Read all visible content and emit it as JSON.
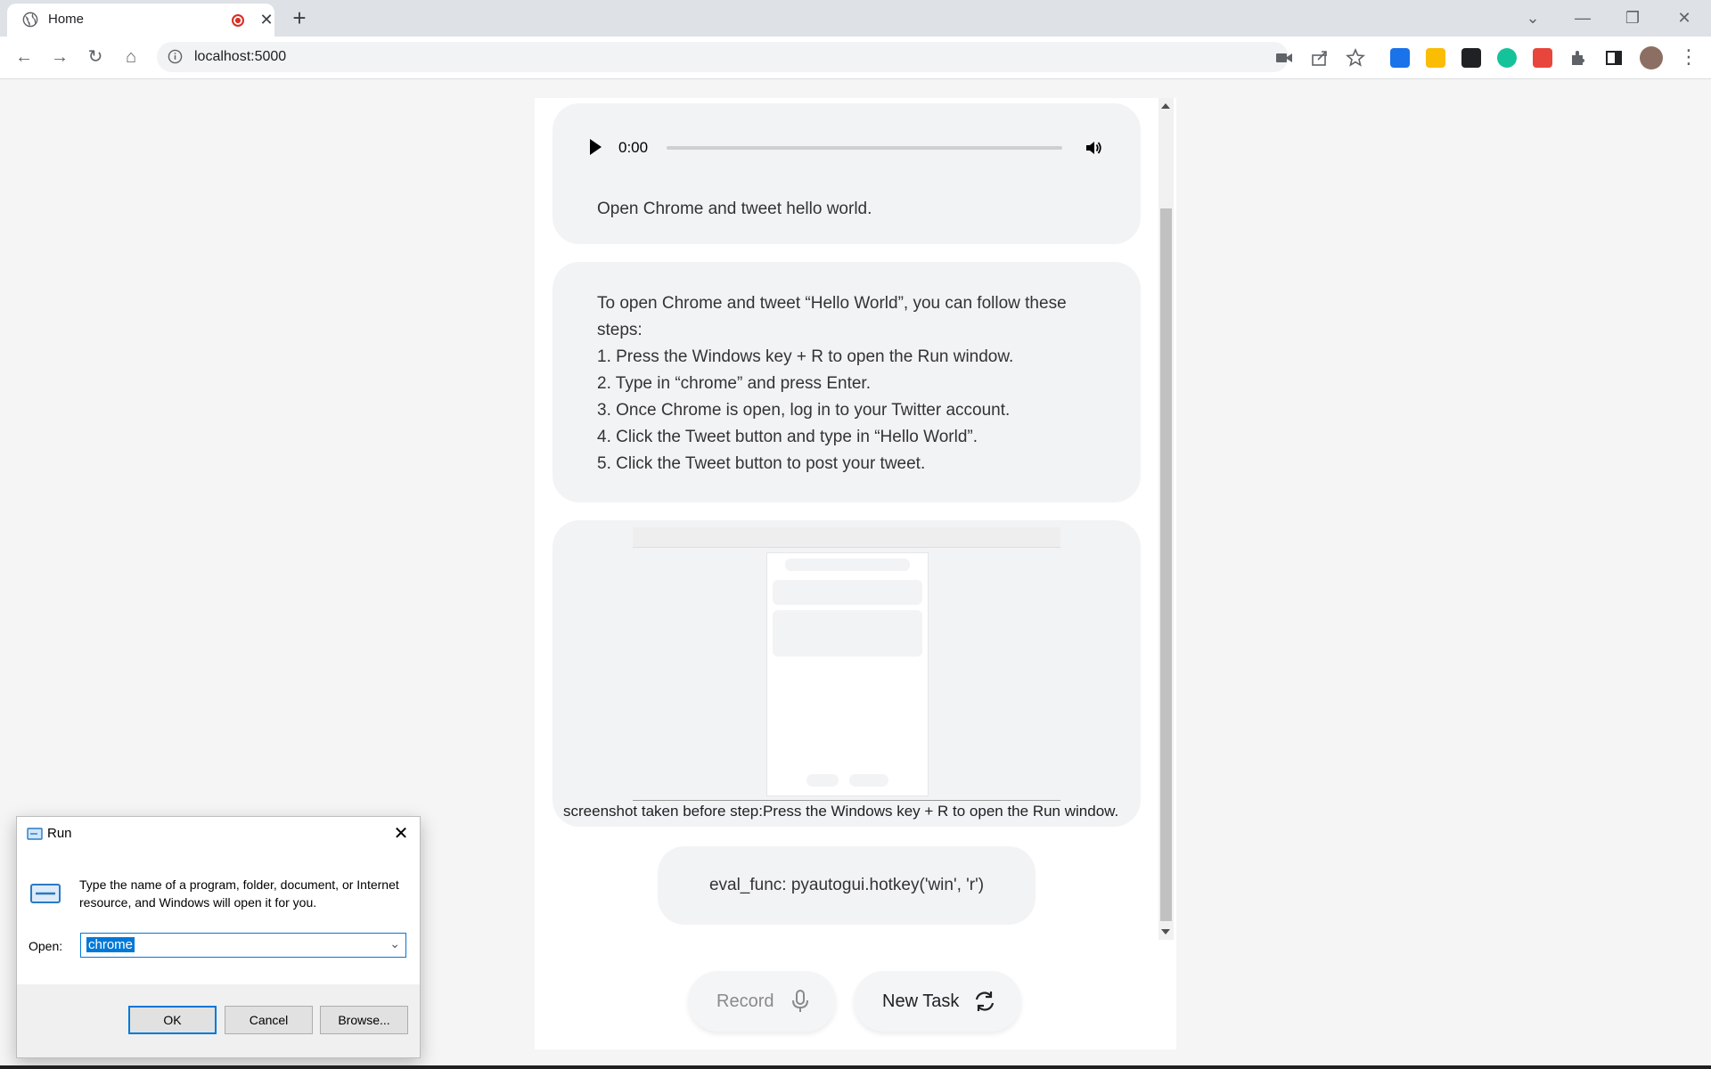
{
  "browser": {
    "tab_title": "Home",
    "new_tab_label": "+",
    "url": "localhost:5000",
    "window_controls": [
      "minimize",
      "restore",
      "close"
    ]
  },
  "page": {
    "audio": {
      "time": "0:00",
      "progress": 0
    },
    "user_message": "Open Chrome and tweet hello world.",
    "assistant_lines": [
      "To open Chrome and tweet “Hello World”, you can follow these",
      "steps:",
      "1. Press the Windows key + R to open the Run window.",
      "2. Type in “chrome” and press Enter.",
      "3. Once Chrome is open, log in to your Twitter account.",
      "4. Click the Tweet button and type in “Hello World”.",
      "5. Click the Tweet button to post your tweet."
    ],
    "screenshot_caption": "screenshot taken before step:Press the Windows key + R to open the Run window.",
    "eval_func": "eval_func: pyautogui.hotkey('win', 'r')",
    "record_label": "Record",
    "new_task_label": "New Task"
  },
  "run_dialog": {
    "title": "Run",
    "description": "Type the name of a program, folder, document, or Internet resource, and Windows will open it for you.",
    "open_label": "Open:",
    "open_value": "chrome",
    "ok_label": "OK",
    "cancel_label": "Cancel",
    "browse_label": "Browse..."
  },
  "colors": {
    "accent_blue": "#0078d7",
    "recording_red": "#d93025",
    "bubble_bg": "#f2f3f5"
  }
}
